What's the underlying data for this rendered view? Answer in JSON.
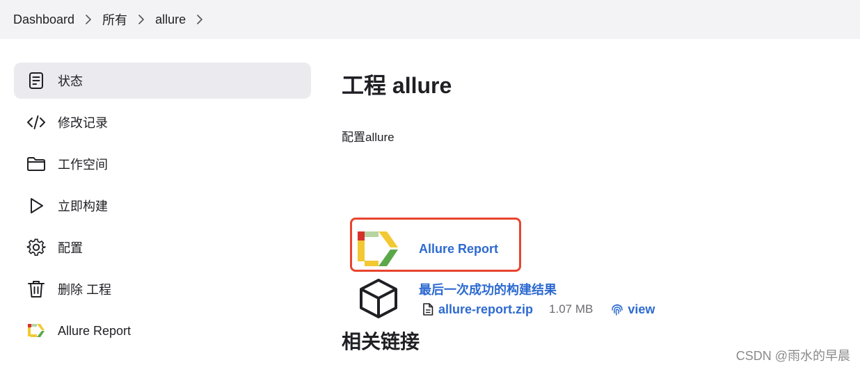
{
  "breadcrumb": [
    {
      "label": "Dashboard"
    },
    {
      "label": "所有"
    },
    {
      "label": "allure"
    }
  ],
  "sidebar": {
    "items": [
      {
        "label": "状态",
        "icon": "document-icon",
        "active": true
      },
      {
        "label": "修改记录",
        "icon": "code-icon"
      },
      {
        "label": "工作空间",
        "icon": "folder-icon"
      },
      {
        "label": "立即构建",
        "icon": "play-icon"
      },
      {
        "label": "配置",
        "icon": "gear-icon"
      },
      {
        "label": "删除 工程",
        "icon": "trash-icon"
      },
      {
        "label": "Allure Report",
        "icon": "allure-logo-icon"
      }
    ]
  },
  "main": {
    "title": "工程 allure",
    "description": "配置allure",
    "allure_link": "Allure Report",
    "artifacts_title": "最后一次成功的构建结果",
    "artifact_file": "allure-report.zip",
    "artifact_size": "1.07 MB",
    "view_label": "view",
    "related_title": "相关链接"
  },
  "watermark": "CSDN @雨水的早晨",
  "colors": {
    "link": "#2d6ad0",
    "highlight": "#e8442e",
    "active_bg": "#ebebef",
    "topbar_bg": "#f3f3f5"
  }
}
